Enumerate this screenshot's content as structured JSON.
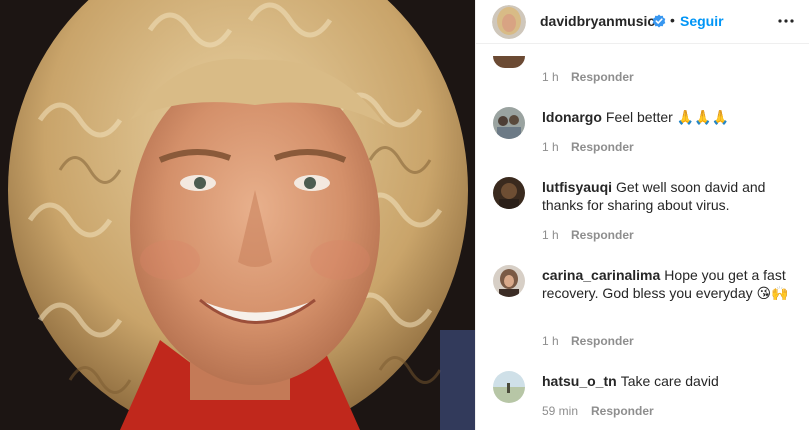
{
  "post": {
    "username": "davidbryanmusic",
    "separator": "•",
    "follow_label": "Seguir"
  },
  "comments": {
    "reply_label": "Responder",
    "first_time": "1 h",
    "items": [
      {
        "username": "ldonargo",
        "text": "Feel better 🙏🙏🙏",
        "time": "1 h"
      },
      {
        "username": "lutfisyauqi",
        "text": "Get well soon david and thanks for sharing about virus.",
        "time": "1 h"
      },
      {
        "username": "carina_carinalima",
        "text": "Hope you get a fast recovery. God bless you everyday 😘🙌",
        "time": "1 h"
      },
      {
        "username": "hatsu_o_tn",
        "text": "Take care david",
        "time": "59 min"
      }
    ]
  },
  "colors": {
    "link_blue": "#0095f6",
    "meta_gray": "#8e8e8e",
    "text": "#262626"
  },
  "icons": {
    "verified": "verified-badge-icon",
    "more": "more-options-icon"
  }
}
